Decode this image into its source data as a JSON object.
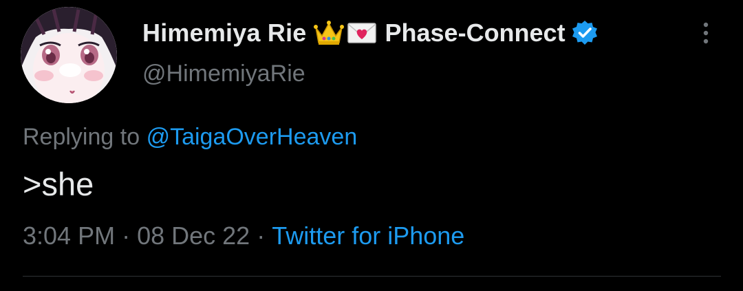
{
  "author": {
    "display_name": "Himemiya Rie",
    "emoji": [
      "crown-icon",
      "love-letter-icon"
    ],
    "org_name": "Phase-Connect",
    "verified": true,
    "handle": "@HimemiyaRie"
  },
  "reply": {
    "prefix": "Replying to",
    "target": "@TaigaOverHeaven"
  },
  "tweet": {
    "text": ">she"
  },
  "meta": {
    "time": "3:04 PM",
    "separator": "·",
    "date": "08 Dec 22",
    "source": "Twitter for iPhone"
  },
  "colors": {
    "background": "#000000",
    "primary_text": "#e7e9ea",
    "secondary_text": "#71767b",
    "link": "#1d9bf0",
    "divider": "#2f3336"
  }
}
